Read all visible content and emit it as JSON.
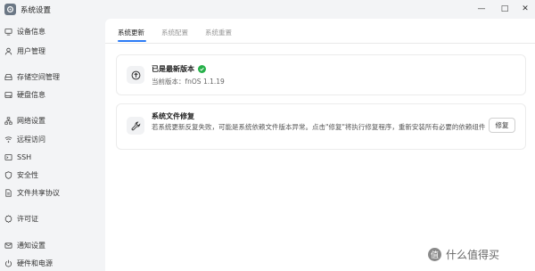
{
  "window": {
    "title": "系统设置",
    "controls": {
      "minimize": "—",
      "maximize": "□",
      "close": "✕"
    }
  },
  "sidebar": {
    "items": [
      {
        "label": "设备信息",
        "icon": "monitor-icon"
      },
      {
        "label": "用户管理",
        "icon": "user-icon"
      },
      {
        "label": "存储空间管理",
        "icon": "storage-icon"
      },
      {
        "label": "硬盘信息",
        "icon": "disk-icon"
      },
      {
        "label": "网络设置",
        "icon": "network-icon"
      },
      {
        "label": "远程访问",
        "icon": "remote-access-icon"
      },
      {
        "label": "SSH",
        "icon": "terminal-icon"
      },
      {
        "label": "安全性",
        "icon": "shield-icon"
      },
      {
        "label": "文件共享协议",
        "icon": "file-share-icon"
      },
      {
        "label": "许可证",
        "icon": "license-icon"
      },
      {
        "label": "通知设置",
        "icon": "mail-icon"
      },
      {
        "label": "硬件和电源",
        "icon": "power-icon"
      }
    ]
  },
  "tabs": [
    {
      "label": "系统更新",
      "active": true
    },
    {
      "label": "系统配置",
      "active": false
    },
    {
      "label": "系统重置",
      "active": false
    }
  ],
  "update_card": {
    "title": "已是最新版本",
    "version_label": "当前版本：",
    "version": "fnOS 1.1.19"
  },
  "repair_card": {
    "title": "系统文件修复",
    "description": "若系统更新反复失败，可能是系统依赖文件版本异常。点击\"修复\"将执行修复程序，重新安装所有必要的依赖组件",
    "button": "修复"
  },
  "watermark": {
    "badge": "值",
    "text": "什么值得买"
  },
  "colors": {
    "accent": "#2c7cf6",
    "success": "#26b049"
  }
}
